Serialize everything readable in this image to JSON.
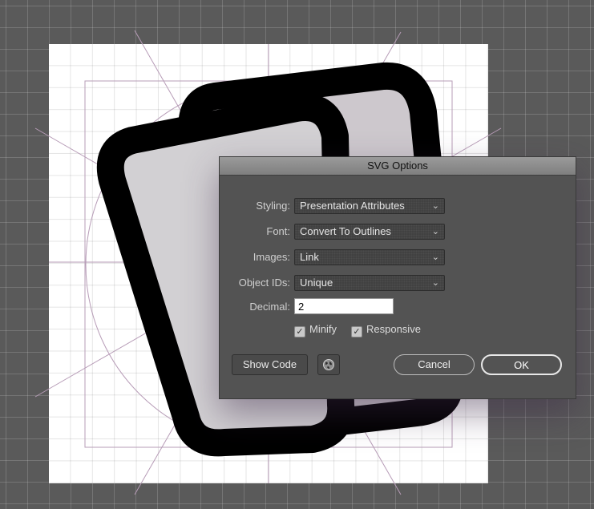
{
  "dialog": {
    "title": "SVG Options",
    "fields": {
      "styling": {
        "label": "Styling:",
        "value": "Presentation Attributes"
      },
      "font": {
        "label": "Font:",
        "value": "Convert To Outlines"
      },
      "images": {
        "label": "Images:",
        "value": "Link"
      },
      "object_ids": {
        "label": "Object IDs:",
        "value": "Unique"
      },
      "decimal": {
        "label": "Decimal:",
        "value": "2"
      }
    },
    "checkboxes": {
      "minify": {
        "label": "Minify",
        "checked": true
      },
      "responsive": {
        "label": "Responsive",
        "checked": true
      }
    },
    "buttons": {
      "show_code": "Show Code",
      "cancel": "Cancel",
      "ok": "OK"
    },
    "icons": {
      "select_arrow": "chevron-down-icon",
      "checkmark": "check-icon",
      "globe": "globe-icon"
    }
  },
  "colors": {
    "pasteboard": "#5a5a5a",
    "dialog_bg": "#535353",
    "artwork_stroke": "#000000",
    "artwork_fill": "#cfcccf",
    "guide": "#b399b3"
  }
}
